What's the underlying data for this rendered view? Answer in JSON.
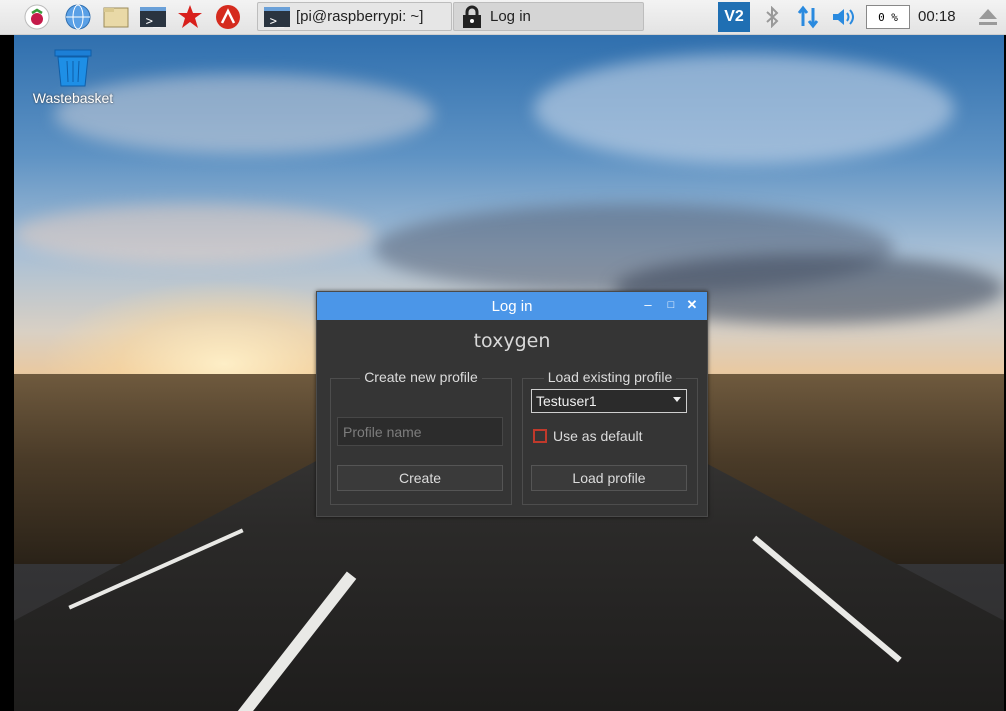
{
  "taskbar": {
    "icons": [
      "raspberry-menu-icon",
      "web-browser-icon",
      "file-manager-icon",
      "terminal-icon",
      "mathematica-icon",
      "wolfram-icon"
    ],
    "tasks": [
      {
        "label": "[pi@raspberrypi: ~]",
        "icon": "terminal-icon"
      },
      {
        "label": "Log in",
        "icon": "lock-icon"
      }
    ],
    "tray": {
      "vnc_label": "V2",
      "cpu_usage": "0 %",
      "clock": "00:18"
    }
  },
  "desktop": {
    "icons": [
      {
        "label": "Wastebasket",
        "icon": "wastebasket-icon"
      }
    ]
  },
  "dialog": {
    "title": "Log in",
    "app_name": "toxygen",
    "create_group": {
      "title": "Create new profile",
      "profile_name_placeholder": "Profile name",
      "create_button": "Create"
    },
    "load_group": {
      "title": "Load existing profile",
      "selected_profile": "Testuser1",
      "use_as_default_label": "Use as default",
      "use_as_default_checked": false,
      "load_button": "Load profile"
    }
  },
  "colors": {
    "titlebar": "#4b96e8",
    "dialog_bg": "#353535",
    "checkbox_border": "#c0392b"
  }
}
